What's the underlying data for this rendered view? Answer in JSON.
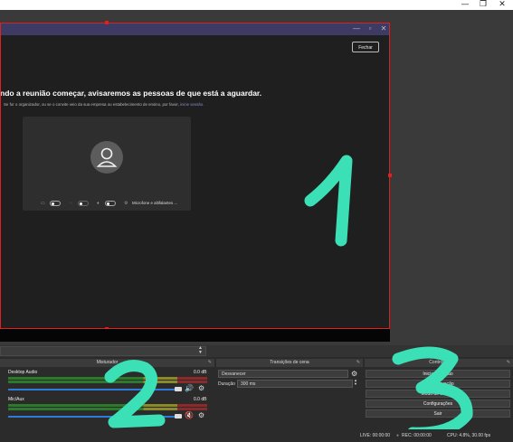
{
  "window": {
    "controls": {
      "minimize": "—",
      "maximize": "❐",
      "close": "✕"
    }
  },
  "preview": {
    "teams": {
      "controls": {
        "minimize": "—",
        "maximize": "▫",
        "close": "✕"
      },
      "close_button": "Fechar",
      "heading": "ndo a reunião começar, avisaremos as pessoas de que está a aguardar.",
      "subtext": "Se for o organizador, ou se o convite veio da sua empresa ou estabelecimento de ensino, por favor,",
      "subtext_link": "inicie sessão.",
      "mic_label": "Microfone e altifalantes ..."
    }
  },
  "docks": {
    "mixer": {
      "title": "Misturador",
      "channels": [
        {
          "name": "Desktop Audio",
          "db": "0.0 dB",
          "muted": false,
          "level": 1.0
        },
        {
          "name": "Mic/Aux",
          "db": "0.0 dB",
          "muted": true,
          "level": 1.0
        }
      ],
      "scale": [
        "-60",
        "-55",
        "-50",
        "-45",
        "-40",
        "-35",
        "-30",
        "-25",
        "-20",
        "-15",
        "-10",
        "-5",
        "0"
      ]
    },
    "transitions": {
      "title": "Transições de cena",
      "transition": "Desvanecer",
      "duration_label": "Duração",
      "duration_value": "300 ms"
    },
    "controls": {
      "title": "Controlos",
      "buttons": [
        "Iniciar emissão",
        "Iniciar gravação",
        "Modo de estúdio",
        "Configurações",
        "Sair"
      ]
    }
  },
  "status": {
    "live": "LIVE: 00:00:00",
    "rec": "REC: 00:00:00",
    "cpu": "CPU: 4.8%, 30.00 fps"
  },
  "annotations": [
    "1",
    "2",
    "3"
  ],
  "colors": {
    "accent_red": "#e02020",
    "annotation": "#3be0b6",
    "teams_bar": "#3d3a64",
    "slider": "#2e7bd8"
  }
}
